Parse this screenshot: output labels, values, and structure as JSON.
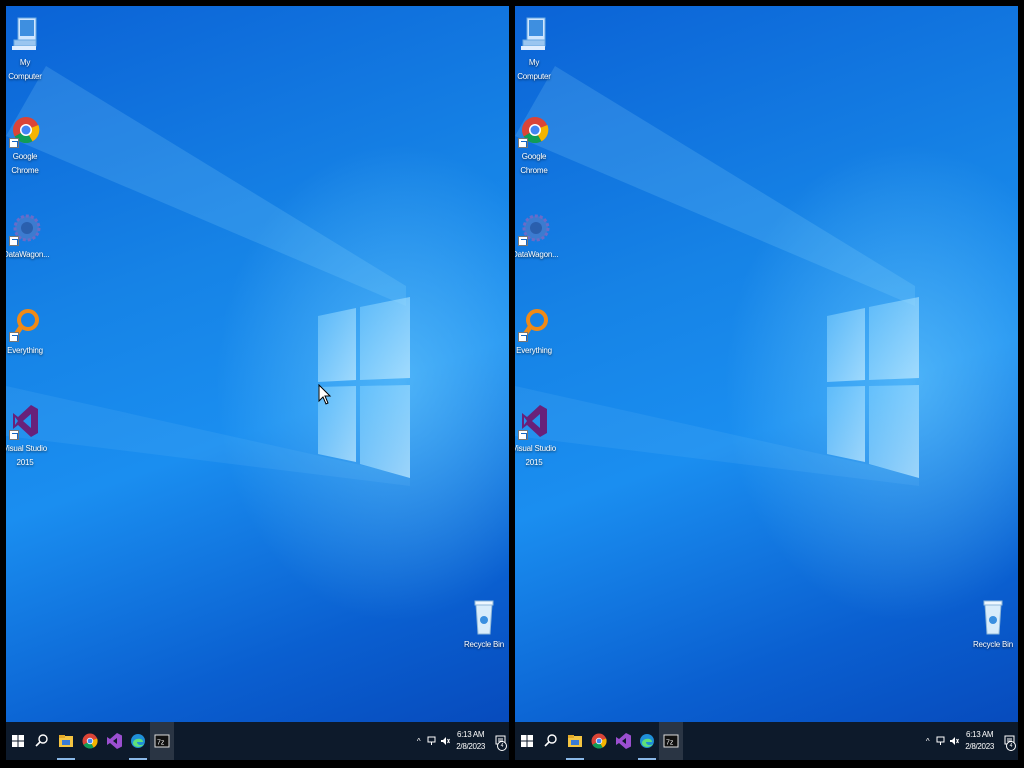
{
  "desktop_icons": [
    {
      "label": "My Computer",
      "icon": "computer-icon"
    },
    {
      "label": "Google Chrome",
      "icon": "chrome-icon"
    },
    {
      "label": "DataWagon...",
      "icon": "datawagon-icon"
    },
    {
      "label": "Everything",
      "icon": "everything-icon"
    },
    {
      "label": "Visual Studio 2015",
      "icon": "visual-studio-icon"
    }
  ],
  "recycle_bin": {
    "label": "Recycle Bin",
    "icon": "recycle-bin-icon"
  },
  "taskbar": {
    "apps": [
      "start-icon",
      "search-icon",
      "file-explorer-icon",
      "chrome-icon",
      "visual-studio-icon",
      "edge-icon",
      "seven-zip-icon"
    ],
    "tray_chevron": "^",
    "clock_time": "6:13 AM",
    "clock_date": "2/8/2023",
    "notification_count": "4"
  },
  "colors": {
    "taskbar": "#0d1a2b",
    "wallpaper_blue": "#1683e6"
  }
}
